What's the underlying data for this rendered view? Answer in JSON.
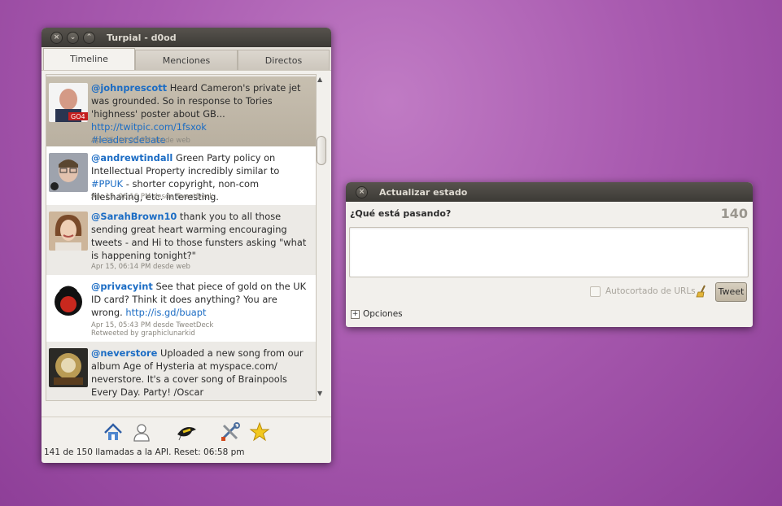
{
  "main_window": {
    "title": "Turpial - d0od",
    "tabs": [
      {
        "label": "Timeline",
        "active": true
      },
      {
        "label": "Menciones",
        "active": false
      },
      {
        "label": "Directos",
        "active": false
      }
    ],
    "tweets": [
      {
        "user": "@johnprescott",
        "text": " Heard Cameron's private jet was grounded. So in response to Tories 'highness' poster about GB... ",
        "link": "http://twitpic.com/1fsxok",
        "hashtag": "#leadersdebate",
        "meta": "Apr 15, 06:23 PM desde web",
        "selected": true
      },
      {
        "user": "@andrewtindall",
        "text_before": " Green Party policy on Intellectual Property incredibly similar to ",
        "hashtag": "#PPUK",
        "text_after": " - shorter copyright, non-com filesharing, etc. interesting.",
        "meta": "Apr 15, 06:16 PM desde TweetDeck"
      },
      {
        "user": "@SarahBrown10",
        "text": " thank you to all those sending great heart warming encouraging tweets - and Hi to those funsters asking \"what is happening tonight?\"",
        "meta": "Apr 15, 06:14 PM desde web"
      },
      {
        "user": "@privacyint",
        "text": " See that piece of gold on the UK ID card?  Think it does anything?  You are wrong. ",
        "link": "http://is.gd/buapt",
        "meta": "Apr 15, 05:43 PM desde TweetDeck",
        "retweet": "Retweeted by graphiclunarkid"
      },
      {
        "user": "@neverstore",
        "text": " Uploaded a new song from our album Age of Hysteria at myspace.com/ neverstore. It's a cover song  of Brainpools Every Day. Party! /Oscar"
      }
    ],
    "toolbar_icons": [
      "home-icon",
      "profile-icon",
      "bird-icon",
      "tools-icon",
      "star-icon"
    ],
    "status": "141 de 150 llamadas a la API. Reset: 06:58 pm"
  },
  "update_window": {
    "title": "Actualizar estado",
    "question": "¿Qué está pasando?",
    "char_count": "140",
    "input_value": "",
    "autoshorten_label": "Autocortado de URLs",
    "autoshorten_checked": false,
    "tweet_button": "Tweet",
    "options_label": "Opciones"
  }
}
